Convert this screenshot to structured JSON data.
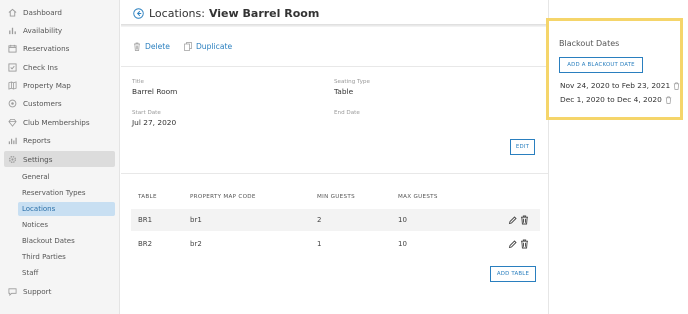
{
  "sidebar": {
    "items": [
      {
        "label": "Dashboard",
        "icon": "home-icon"
      },
      {
        "label": "Availability",
        "icon": "bars-icon"
      },
      {
        "label": "Reservations",
        "icon": "calendar-icon"
      },
      {
        "label": "Check Ins",
        "icon": "checkin-icon"
      },
      {
        "label": "Property Map",
        "icon": "map-icon"
      },
      {
        "label": "Customers",
        "icon": "customers-icon"
      },
      {
        "label": "Club Memberships",
        "icon": "diamond-icon"
      },
      {
        "label": "Reports",
        "icon": "reports-icon"
      },
      {
        "label": "Settings",
        "icon": "gear-icon"
      }
    ],
    "settings_sub": [
      "General",
      "Reservation Types",
      "Locations",
      "Notices",
      "Blackout Dates",
      "Third Parties",
      "Staff"
    ],
    "support": {
      "label": "Support",
      "icon": "support-icon"
    }
  },
  "header": {
    "prefix": "Locations:",
    "title": "View Barrel Room"
  },
  "actions": {
    "delete": "Delete",
    "duplicate": "Duplicate"
  },
  "details": {
    "title_label": "Title",
    "title_value": "Barrel Room",
    "seating_label": "Seating Type",
    "seating_value": "Table",
    "start_label": "Start Date",
    "start_value": "Jul 27, 2020",
    "end_label": "End Date",
    "end_value": "",
    "edit_button": "EDIT"
  },
  "tables": {
    "columns": [
      "TABLE",
      "PROPERTY MAP CODE",
      "MIN GUESTS",
      "MAX GUESTS"
    ],
    "rows": [
      {
        "table": "BR1",
        "code": "br1",
        "min": "2",
        "max": "10"
      },
      {
        "table": "BR2",
        "code": "br2",
        "min": "1",
        "max": "10"
      }
    ],
    "add_button": "ADD TABLE"
  },
  "blackout": {
    "title": "Blackout Dates",
    "add_button": "ADD A BLACKOUT DATE",
    "ranges": [
      "Nov 24, 2020 to Feb 23, 2021",
      "Dec 1, 2020 to Dec 4, 2020"
    ]
  },
  "colors": {
    "accent": "#2a7fbf",
    "highlight": "#f5d56a",
    "active_sub_bg": "#c8dff2"
  }
}
